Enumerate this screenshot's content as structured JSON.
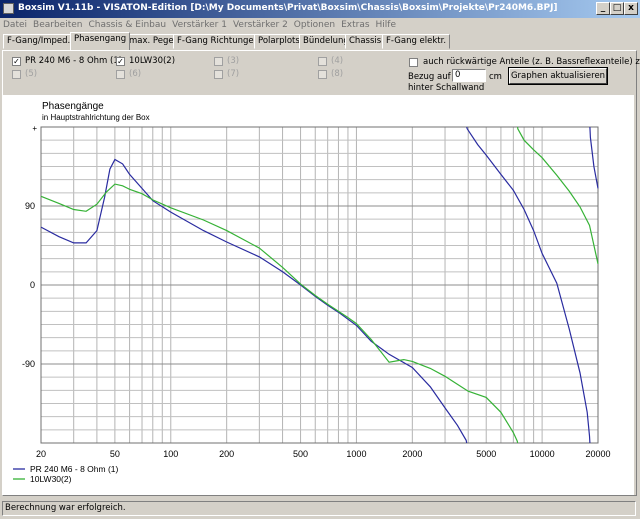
{
  "window": {
    "title": "Boxsim V1.11b - VISATON-Edition [D:\\My Documents\\Privat\\Boxsim\\Chassis\\Boxsim\\Projekte\\Pr240M6.BPJ]",
    "min_glyph": "_",
    "max_glyph": "□",
    "close_glyph": "x"
  },
  "menu": [
    "Datei",
    "Bearbeiten",
    "Chassis & Einbau",
    "Verstärker 1",
    "Verstärker 2",
    "Optionen",
    "Extras",
    "Hilfe"
  ],
  "tabs": [
    "F-Gang/Imped.",
    "Phasengang",
    "max. Pegel",
    "F-Gang Richtungen",
    "Polarplots",
    "Bündelung",
    "Chassis",
    "F-Gang elektr."
  ],
  "active_tab": "Phasengang",
  "options": {
    "drivers": [
      {
        "label": "PR 240 M6 - 8 Ohm (1)",
        "checked": true,
        "enabled": true
      },
      {
        "label": "10LW30(2)",
        "checked": true,
        "enabled": true
      },
      {
        "label": "(3)",
        "checked": false,
        "enabled": false
      },
      {
        "label": "(4)",
        "checked": false,
        "enabled": false
      },
      {
        "label": "(5)",
        "checked": false,
        "enabled": false
      },
      {
        "label": "(6)",
        "checked": false,
        "enabled": false
      },
      {
        "label": "(7)",
        "checked": false,
        "enabled": false
      },
      {
        "label": "(8)",
        "checked": false,
        "enabled": false
      }
    ],
    "rear_label": "auch rückwärtige Anteile (z. B. Bassreflexanteile) zeigen",
    "bezug_label": "Bezug auf",
    "bezug_value": "0",
    "bezug_unit": "cm",
    "bezug_label2": "hinter Schallwand",
    "update_button": "Graphen aktualisieren"
  },
  "chart_data": {
    "type": "line",
    "title": "Phasengänge",
    "subtitle": "in Hauptstrahlrichtung der Box",
    "xscale": "log",
    "xlim": [
      20,
      20000
    ],
    "ylim": [
      -180,
      180
    ],
    "x_ticks": [
      "20",
      "50",
      "100",
      "200",
      "500",
      "1000",
      "2000",
      "5000",
      "10000",
      "20000"
    ],
    "x_tick_values": [
      20,
      50,
      100,
      200,
      500,
      1000,
      2000,
      5000,
      10000,
      20000
    ],
    "y_ticks": [
      "90",
      "0",
      "-90"
    ],
    "y_tick_values": [
      90,
      0,
      -90
    ],
    "grid": true,
    "legend_position": "bottom-left",
    "series": [
      {
        "name": "PR 240 M6 - 8 Ohm (1)",
        "color": "#2a2ca0",
        "points": [
          [
            20,
            66
          ],
          [
            25,
            55
          ],
          [
            30,
            48
          ],
          [
            35,
            48
          ],
          [
            40,
            62
          ],
          [
            44,
            100
          ],
          [
            47,
            132
          ],
          [
            50,
            143
          ],
          [
            55,
            138
          ],
          [
            60,
            126
          ],
          [
            70,
            110
          ],
          [
            80,
            96
          ],
          [
            100,
            83
          ],
          [
            150,
            62
          ],
          [
            200,
            49
          ],
          [
            300,
            32
          ],
          [
            400,
            15
          ],
          [
            500,
            0
          ],
          [
            600,
            -13
          ],
          [
            700,
            -23
          ],
          [
            800,
            -31
          ],
          [
            900,
            -39
          ],
          [
            1000,
            -46
          ],
          [
            1200,
            -64
          ],
          [
            1500,
            -79
          ],
          [
            2000,
            -94
          ],
          [
            2500,
            -116
          ],
          [
            3000,
            -140
          ],
          [
            3500,
            -160
          ],
          [
            3900,
            -177
          ],
          [
            3950,
            178
          ],
          [
            4500,
            160
          ],
          [
            5000,
            148
          ],
          [
            6000,
            126
          ],
          [
            7000,
            108
          ],
          [
            8000,
            86
          ],
          [
            9000,
            62
          ],
          [
            10000,
            36
          ],
          [
            12000,
            2
          ],
          [
            14000,
            -50
          ],
          [
            16000,
            -100
          ],
          [
            17500,
            -145
          ],
          [
            18000,
            -172
          ],
          [
            18200,
            168
          ],
          [
            19000,
            135
          ],
          [
            20000,
            110
          ]
        ]
      },
      {
        "name": "10LW30(2)",
        "color": "#36b236",
        "points": [
          [
            20,
            101
          ],
          [
            25,
            93
          ],
          [
            30,
            86
          ],
          [
            35,
            84
          ],
          [
            40,
            92
          ],
          [
            45,
            106
          ],
          [
            50,
            115
          ],
          [
            55,
            113
          ],
          [
            60,
            109
          ],
          [
            70,
            104
          ],
          [
            80,
            97
          ],
          [
            100,
            88
          ],
          [
            150,
            74
          ],
          [
            200,
            62
          ],
          [
            300,
            42
          ],
          [
            400,
            20
          ],
          [
            500,
            1
          ],
          [
            600,
            -12
          ],
          [
            700,
            -22
          ],
          [
            800,
            -30
          ],
          [
            900,
            -37
          ],
          [
            1000,
            -44
          ],
          [
            1200,
            -62
          ],
          [
            1500,
            -88
          ],
          [
            1800,
            -85
          ],
          [
            2000,
            -87
          ],
          [
            2500,
            -95
          ],
          [
            3000,
            -104
          ],
          [
            4000,
            -121
          ],
          [
            5000,
            -128
          ],
          [
            6000,
            -145
          ],
          [
            7000,
            -168
          ],
          [
            7350,
            -178
          ],
          [
            7400,
            178
          ],
          [
            8000,
            165
          ],
          [
            9000,
            154
          ],
          [
            10000,
            145
          ],
          [
            12000,
            125
          ],
          [
            14000,
            107
          ],
          [
            16000,
            89
          ],
          [
            18000,
            68
          ],
          [
            20000,
            24
          ]
        ]
      }
    ]
  },
  "status": "Berechnung war erfolgreich."
}
